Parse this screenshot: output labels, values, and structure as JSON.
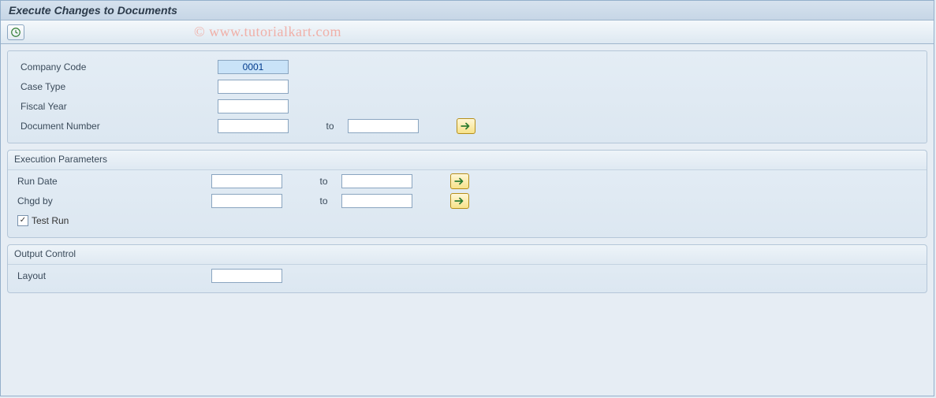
{
  "title": "Execute Changes to Documents",
  "watermark": "© www.tutorialkart.com",
  "fields": {
    "companyCode": {
      "label": "Company Code",
      "value": "0001"
    },
    "caseType": {
      "label": "Case Type",
      "value": ""
    },
    "fiscalYear": {
      "label": "Fiscal Year",
      "value": ""
    },
    "docNumber": {
      "label": "Document Number",
      "from": "",
      "to_label": "to",
      "to": ""
    }
  },
  "groups": {
    "exec": {
      "title": "Execution Parameters",
      "runDate": {
        "label": "Run Date",
        "from": "",
        "to_label": "to",
        "to": ""
      },
      "chgdBy": {
        "label": "Chgd by",
        "from": "",
        "to_label": "to",
        "to": ""
      },
      "testRun": {
        "label": "Test Run",
        "checked": true
      }
    },
    "output": {
      "title": "Output Control",
      "layout": {
        "label": "Layout",
        "value": ""
      }
    }
  }
}
